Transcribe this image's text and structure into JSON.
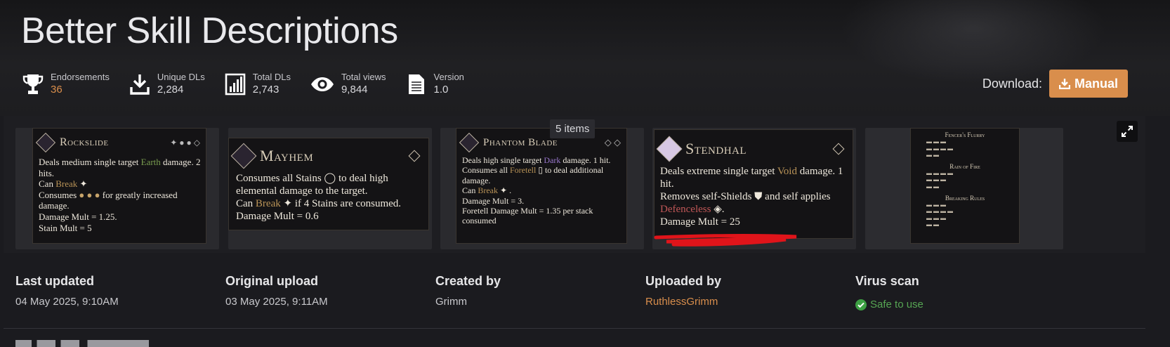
{
  "header": {
    "title": "Better Skill Descriptions"
  },
  "stats": [
    {
      "label": "Endorsements",
      "value": "36",
      "icon": "trophy-icon"
    },
    {
      "label": "Unique DLs",
      "value": "2,284",
      "icon": "download-icon"
    },
    {
      "label": "Total DLs",
      "value": "2,743",
      "icon": "bar-chart-icon"
    },
    {
      "label": "Total views",
      "value": "9,844",
      "icon": "eye-icon"
    },
    {
      "label": "Version",
      "value": "1.0",
      "icon": "document-icon"
    }
  ],
  "download": {
    "label": "Download:",
    "button": "Manual"
  },
  "gallery": {
    "count": "5 items",
    "cards": [
      {
        "name": "Rockslide",
        "lines": [
          "Deals medium single target ",
          "Earth",
          " damage. 2 hits.",
          "Can ",
          "Break",
          "Consumes",
          " for greatly increased damage.",
          "Damage Mult = 1.25.",
          "Stain Mult = 5"
        ]
      },
      {
        "name": "Mayhem",
        "lines": [
          "Consumes all Stains",
          " to deal high elemental damage to the target.",
          "Can ",
          "Break",
          " if 4 Stains are consumed.",
          "Damage Mult = 0.6"
        ]
      },
      {
        "name": "Phantom Blade",
        "lines": [
          "Deals high single target ",
          "Dark",
          " damage. 1 hit.",
          "Consumes all ",
          "Foretell",
          " to deal additional damage.",
          "Can ",
          "Break",
          " .",
          "Damage Mult = 3.",
          "Foretell Damage Mult = 1.35 per stack consumed"
        ]
      },
      {
        "name": "Stendhal",
        "lines": [
          "Deals extreme single target ",
          "Void",
          " damage. 1 hit.",
          "Removes self-Shields",
          " and self applies",
          "Defenceless",
          ".",
          "Damage Mult = 25"
        ]
      },
      {
        "name": "",
        "sections": [
          "Fencer's Flurry",
          "Rain of Fire",
          "Breaking Rules"
        ]
      }
    ]
  },
  "meta": [
    {
      "heading": "Last updated",
      "value": "04 May 2025,   9:10AM"
    },
    {
      "heading": "Original upload",
      "value": "03 May 2025,   9:11AM"
    },
    {
      "heading": "Created by",
      "value": "Grimm"
    },
    {
      "heading": "Uploaded by",
      "value": "RuthlessGrimm"
    },
    {
      "heading": "Virus scan",
      "value": "Safe to use"
    }
  ],
  "colors": {
    "accent": "#d98e4c",
    "safe": "#56a553",
    "background": "#1b1b1f"
  }
}
